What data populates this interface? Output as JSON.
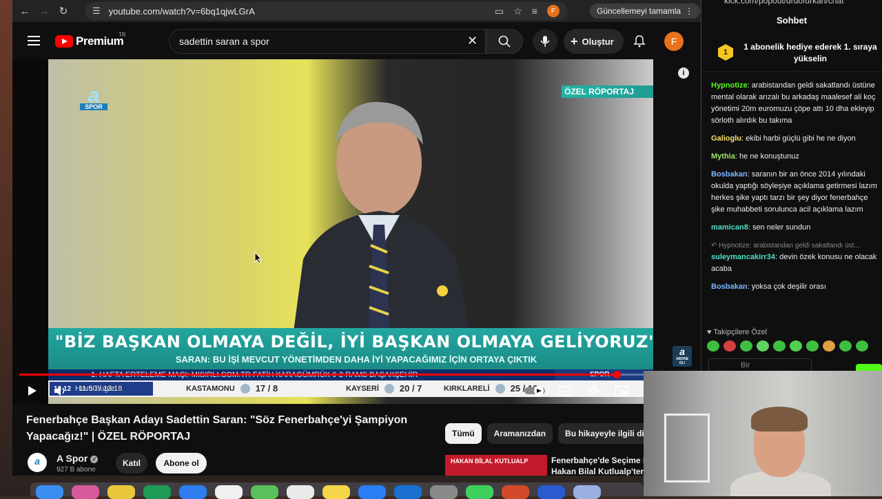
{
  "browser": {
    "url": "youtube.com/watch?v=6bq1qjwLGrA",
    "update_label": "Güncellemeyi tamamla",
    "profile_initial": "F"
  },
  "yt": {
    "logo_text": "Premium",
    "logo_badge": "TR",
    "search_value": "sadettin saran a spor",
    "create_label": "Oluştur",
    "avatar_initial": "F"
  },
  "video": {
    "channel_logo": "a",
    "channel_logo_sub": "SPOR",
    "tag": "ÖZEL RÖPORTAJ",
    "banner_main": "\"BİZ BAŞKAN OLMAYA DEĞİL, İYİ BAŞKAN OLMAYA GELİYORUZ\"",
    "banner_sub": "SARAN: BU İŞİ MEVCUT YÖNETİMDEN DAHA İYİ YAPACAĞIMIZ İÇİN ORTAYA ÇIKTIK",
    "ticker": "1. HAFTA ERTELEME MAÇI: MISIRLI.COM.TR FATİH KARAGÜMRÜK 0-2 RAMS BAŞAKŞEHİR",
    "ticker_right": "SPOR",
    "ticker_left_num": "13 12",
    "ticker_left_label": "Hava Bugün",
    "scores": [
      {
        "city": "KASTAMONU",
        "value": "17 / 8"
      },
      {
        "city": "KAYSERİ",
        "value": "20 / 7"
      },
      {
        "city": "KIRKLARELİ",
        "value": "25 / 12"
      }
    ],
    "corner_logo": "a",
    "corner_sub": "ABONE OL!",
    "time": "11:50 / 13:18",
    "progress": 0.953
  },
  "title": {
    "text": "Fenerbahçe Başkan Adayı Sadettin Saran: \"Söz Fenerbahçe'yi Şampiyon Yapacağız!\" | ÖZEL RÖPORTAJ",
    "channel": "A Spor",
    "subs": "927 B abone",
    "join_label": "Katıl",
    "subscribe_label": "Abone ol",
    "channel_avatar": "a"
  },
  "chips": [
    "Tümü",
    "Aramanızdan",
    "Bu hikayeyle ilgili diğe"
  ],
  "recommendation": {
    "thumb_text": "HAKAN BİLAL KUTLUALP",
    "title_line1": "Fenerbahçe'de Seçime D",
    "title_line2": "Hakan Bilal Kutlualp'ten"
  },
  "chat": {
    "url": "kick.com/popout/drdofurkan/chat",
    "header": "Sohbet",
    "goal_badge": "1",
    "goal_text": "1 abonelik hediye ederek 1. sıraya yükselin",
    "messages": [
      {
        "user": "Hypnotize",
        "text": "arabistandan geldi sakatlandı üstüne mental olarak arızalı bu arkadaş maalesef ali koç yönetimi 20m euromuzu çöpe attı 10 dha ekleyip sörloth alırdık bu takıma",
        "style": "u-green"
      },
      {
        "user": "Galioglu",
        "text": "ekibi harbi güçlü gibi he ne diyon",
        "style": "u-yellow"
      },
      {
        "user": "Mythia",
        "text": "he ne konuştunuz",
        "style": "u-lime"
      },
      {
        "user": "Bosbakan",
        "text": "saranın bir an önce 2014 yılındaki okulda yaptığı söyleşiye açıklama getirmesi lazım herkes şike yaptı tarzı bir şey diyor fenerbahçe şike muhabbeti sorulunca acil açıklama lazım",
        "style": "u-blue"
      },
      {
        "user": "mamican8",
        "text": "sen neler sundun",
        "style": "u-teal"
      },
      {
        "user": "suleymancakirr34",
        "text": "devin özek konusu ne olacak acaba",
        "style": "u-teal",
        "reply": "Hypnotize: arabistandan geldi sakatlandı üst..."
      },
      {
        "user": "Bosbakan",
        "text": "yoksa çok deşilir orası",
        "style": "u-blue"
      }
    ],
    "emote_label": "Takipçilere Özel",
    "input_placeholder": "Bir"
  }
}
